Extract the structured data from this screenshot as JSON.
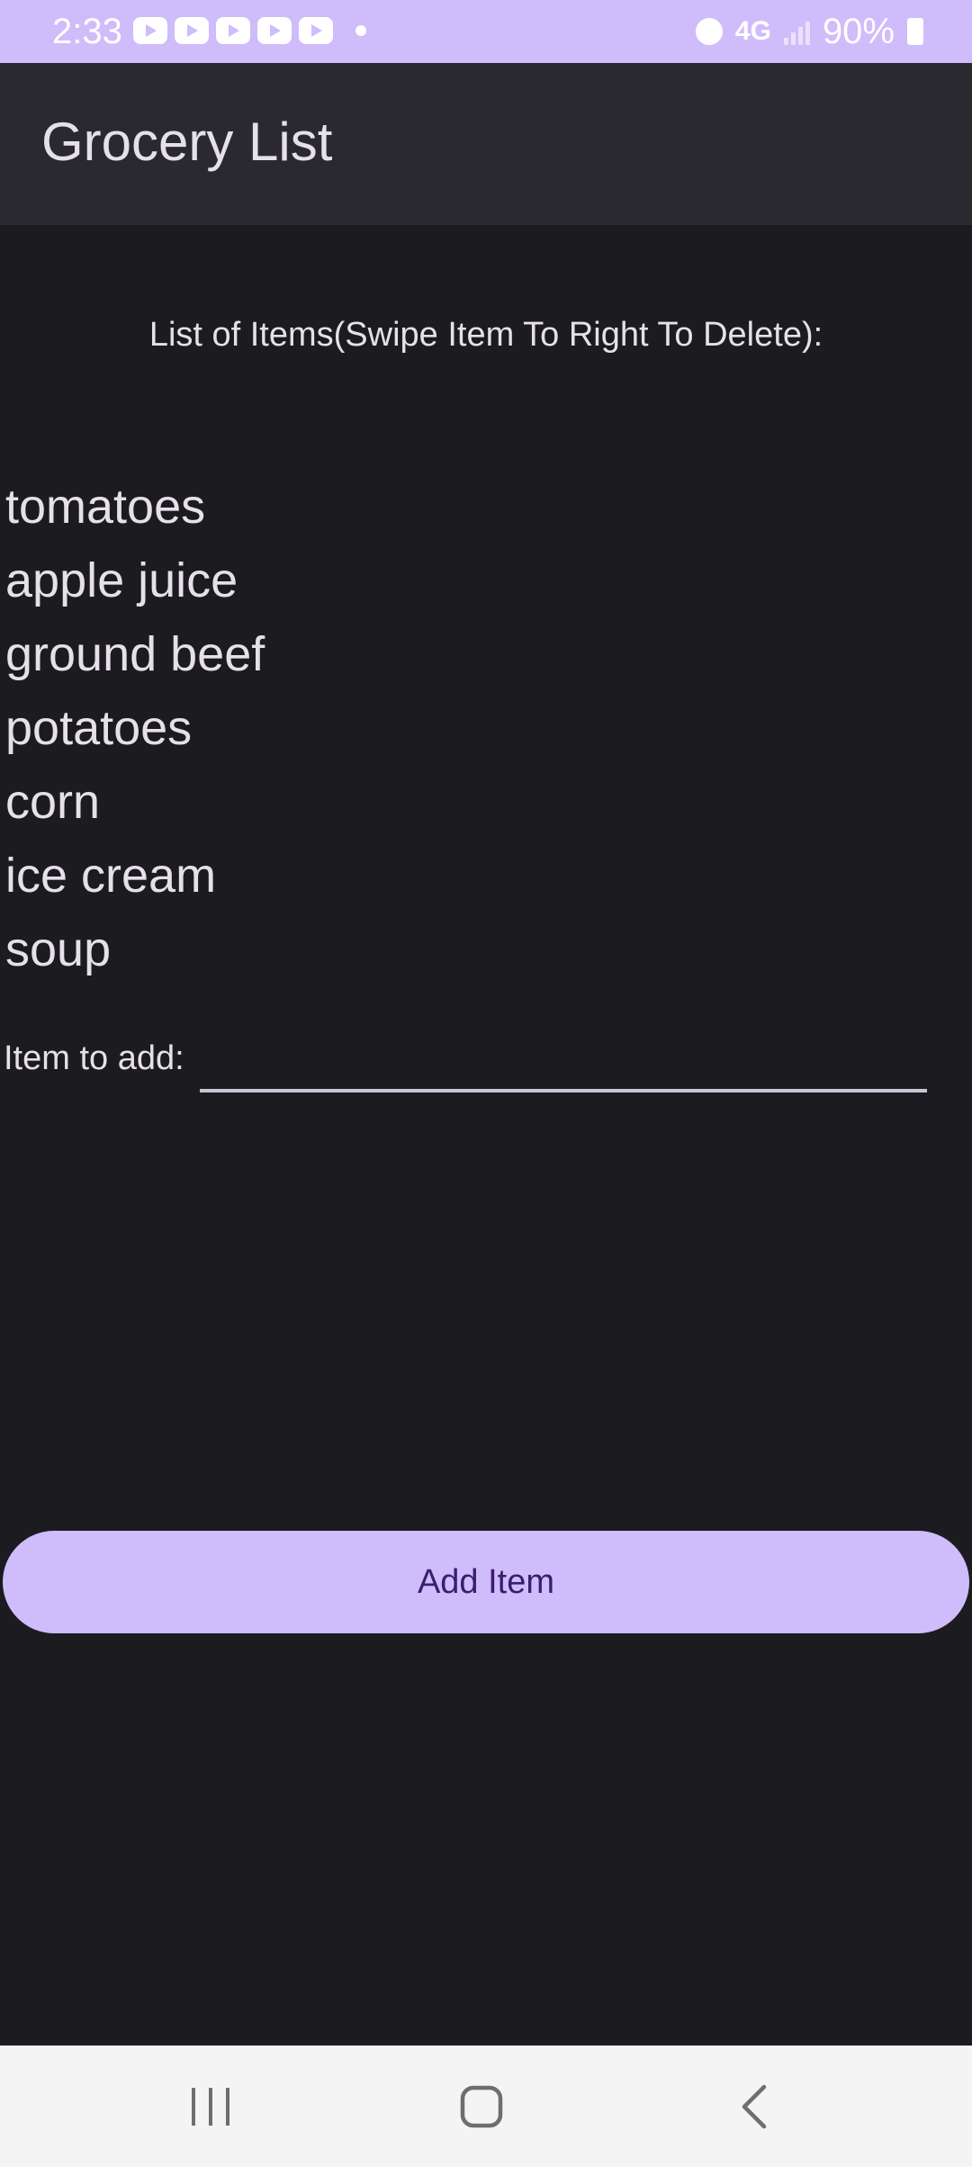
{
  "status_bar": {
    "time": "2:33",
    "network": "4G",
    "battery": "90%"
  },
  "app_bar": {
    "title": "Grocery List"
  },
  "list": {
    "heading": "List of Items(Swipe Item To Right To Delete):",
    "items": [
      "tomatoes",
      "apple juice",
      "ground beef",
      "potatoes",
      "corn",
      "ice cream",
      "soup"
    ]
  },
  "form": {
    "label": "Item to add:",
    "value": "",
    "placeholder": ""
  },
  "actions": {
    "add_label": "Add Item"
  },
  "colors": {
    "accent": "#cfbcfa",
    "background": "#1c1b20",
    "app_bar": "#2b2930",
    "on_accent": "#3a1d70"
  }
}
